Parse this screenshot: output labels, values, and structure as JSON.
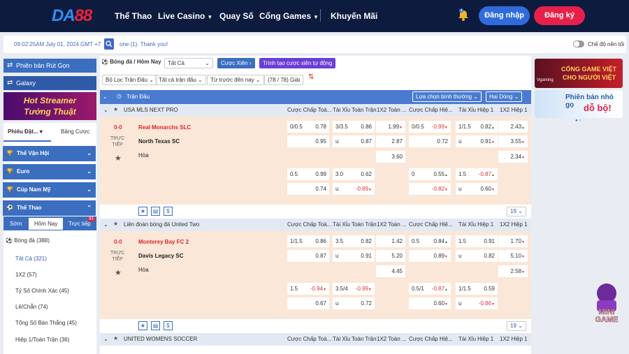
{
  "header": {
    "logo_da": "DA",
    "logo_num": "88",
    "nav": [
      "Thể Thao",
      "Live Casino",
      "Quay Số",
      "Cổng Games",
      "Khuyến Mãi"
    ],
    "login": "Đăng nhập",
    "register": "Đăng ký",
    "bell_badge": "4"
  },
  "bar": {
    "datetime": "09:02:25AM July 01, 2024 GMT +7",
    "marquee": "one (1). Thank you!",
    "dark_mode": "Chế độ nền tối"
  },
  "left": {
    "btn1": "Phiên bản Rút Gọn",
    "btn2": "Galaxy",
    "hot": "Hot Streamer",
    "hot2": "Tưởng Thuật",
    "tab1": "Phiếu Đặt...",
    "tab2": "Bảng Cược",
    "sports": [
      "Thể Vận Hội",
      "Euro",
      "Cúp Nam Mỹ",
      "Thể Thao"
    ],
    "subtabs": [
      "Sớm",
      "Hôm Nay",
      "Trực tiếp"
    ],
    "live_badge": "93",
    "football": "Bóng đá (388)",
    "list": [
      "Tất Cả (321)",
      "1X2 (57)",
      "Tỷ Số Chính Xác (45)",
      "Lẻ/Chẵn (74)",
      "Tổng Số Bàn Thắng (45)",
      "Hiệp 1/Toàn Trận (36)"
    ]
  },
  "main": {
    "title": "Bóng đá / Hôm Nay",
    "sel": "Tất Cả",
    "parlay": "Cược Xiên",
    "builder": "Trình tạo cược xiên tự động",
    "f1": "Bộ Lọc Trận Đấu",
    "f2": "Tất cả trận đấu",
    "f3": "Từ trước đến nay",
    "f4": "(78 / 78) Giải",
    "matches_hdr": "Trận Đấu",
    "odds_sel": "Lựa chọn bình thường",
    "view_sel": "Hai Dòng",
    "cols": [
      "Cược Chấp Toà...",
      "Tài Xỉu Toàn Trận",
      "1X2 Toàn ...",
      "Cược Chấp Hiệ...",
      "Tài Xỉu Hiệp 1",
      "1X2 Hiệp 1"
    ],
    "leagues": [
      {
        "name": "USA MLS NEXT PRO",
        "score": "0-0",
        "live": "TRỰC TIẾP",
        "home": "Real Monarchs SLC",
        "away": "North Texas SC",
        "draw": "Hòa",
        "rows": [
          [
            [
              "0/0.5",
              "0.78",
              ""
            ],
            [
              "3/3.5",
              "0.86",
              ""
            ],
            [
              "",
              "1.99",
              "r"
            ],
            [
              "0/0.5",
              "-0.99",
              "r"
            ],
            [
              "1/1.5",
              "0.82",
              "g"
            ],
            [
              "",
              "2.43",
              "g"
            ]
          ],
          [
            [
              "",
              "0.95",
              ""
            ],
            [
              "u",
              "0.87",
              ""
            ],
            [
              "",
              "2.87",
              ""
            ],
            [
              "",
              "0.72",
              ""
            ],
            [
              "u",
              "0.91",
              "r"
            ],
            [
              "",
              "3.55",
              "r"
            ]
          ],
          [
            null,
            null,
            [
              "",
              "3.60",
              ""
            ],
            null,
            null,
            [
              "",
              "2.34",
              "r"
            ]
          ],
          [
            [
              "0.5",
              "0.99",
              ""
            ],
            [
              "3.0",
              "0.62",
              ""
            ],
            null,
            [
              "0",
              "0.55",
              "g"
            ],
            [
              "1.5",
              "-0.87",
              "g"
            ],
            null
          ],
          [
            [
              "",
              "0.74",
              ""
            ],
            [
              "u",
              "-0.89",
              "r"
            ],
            null,
            [
              "",
              "-0.82",
              "r"
            ],
            [
              "u",
              "0.60",
              "r"
            ],
            null
          ]
        ],
        "page": "19"
      },
      {
        "name": "Liên đoàn bóng đá United Two",
        "score": "0-0",
        "live": "TRỰC TIẾP",
        "home": "Monterey Bay FC 2",
        "away": "Davis Legacy SC",
        "draw": "Hòa",
        "rows": [
          [
            [
              "1/1.5",
              "0.86",
              ""
            ],
            [
              "3.5",
              "0.82",
              ""
            ],
            [
              "",
              "1.42",
              ""
            ],
            [
              "0.5",
              "0.84",
              "g"
            ],
            [
              "1.5",
              "0.91",
              ""
            ],
            [
              "",
              "1.70",
              "r"
            ]
          ],
          [
            [
              "",
              "0.87",
              ""
            ],
            [
              "u",
              "0.91",
              ""
            ],
            [
              "",
              "5.20",
              ""
            ],
            [
              "",
              "0.89",
              "r"
            ],
            [
              "u",
              "0.82",
              ""
            ],
            [
              "",
              "5.10",
              "r"
            ]
          ],
          [
            null,
            null,
            [
              "",
              "4.45",
              ""
            ],
            null,
            null,
            [
              "",
              "2.58",
              "r"
            ]
          ],
          [
            [
              "1.5",
              "-0.94",
              "r"
            ],
            [
              "3.5/4",
              "-0.99",
              "r"
            ],
            null,
            [
              "0.5/1",
              "-0.87",
              "g"
            ],
            [
              "1/1.5",
              "0.59",
              ""
            ],
            null
          ],
          [
            [
              "",
              "0.67",
              ""
            ],
            [
              "u",
              "0.72",
              ""
            ],
            null,
            [
              "",
              "0.60",
              "r"
            ],
            [
              "u",
              "-0.86",
              "r"
            ],
            null
          ]
        ],
        "page": "19"
      },
      {
        "name": "UNITED WOMENS SOCCER"
      }
    ]
  },
  "right": {
    "b1a": "CỔNG GAME VIỆT",
    "b1b": "CHO NGƯỜI VIỆT",
    "b1c": "Vgaming",
    "b2a": "Phiên bản nhỏ gọ",
    "b2b": "dỗ bộ!",
    "mini": "MINI GAME"
  }
}
